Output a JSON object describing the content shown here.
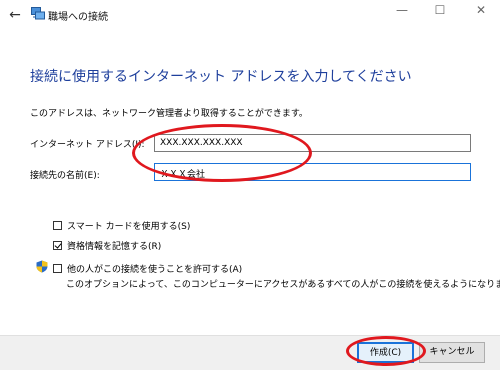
{
  "window": {
    "title": "職場への接続",
    "back_symbol": "←",
    "minimize_symbol": "—",
    "maximize_symbol": "☐",
    "close_symbol": "✕"
  },
  "main": {
    "heading": "接続に使用するインターネット アドレスを入力してください",
    "description": "このアドレスは、ネットワーク管理者より取得することができます。",
    "internet_address_label": "インターネット アドレス(I):",
    "internet_address_value": "XXX.XXX.XXX.XXX",
    "destination_name_label": "接続先の名前(E):",
    "destination_name_value": "ＸＸＸ会社",
    "options": [
      {
        "label": "スマート カードを使用する(S)",
        "checked": false
      },
      {
        "label": "資格情報を記憶する(R)",
        "checked": true
      },
      {
        "label": "他の人がこの接続を使うことを許可する(A)",
        "checked": false
      }
    ],
    "allow_others_note": "このオプションによって、このコンピューターにアクセスがあるすべての人がこの接続を使えるようになります。"
  },
  "footer": {
    "create_label": "作成(C)",
    "cancel_label": "キャンセル"
  },
  "colors": {
    "heading": "#1e3f9c",
    "highlight_ellipse": "#e0181e",
    "focus_border": "#1a73d9"
  }
}
